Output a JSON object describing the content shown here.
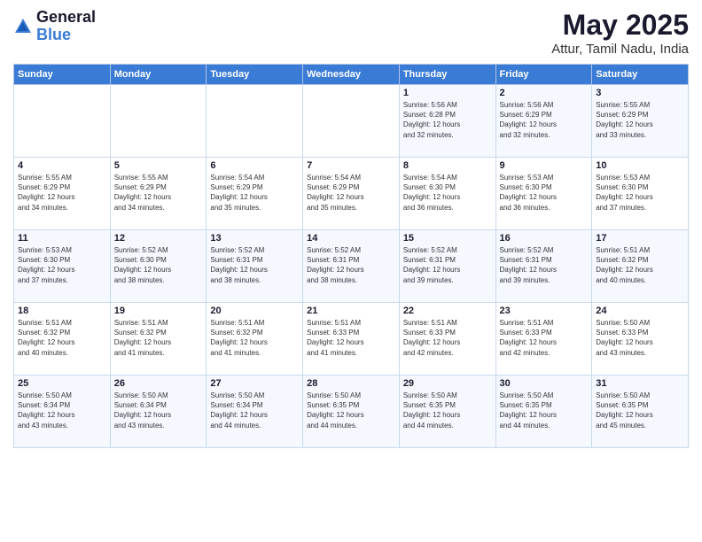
{
  "logo": {
    "general": "General",
    "blue": "Blue"
  },
  "title": "May 2025",
  "subtitle": "Attur, Tamil Nadu, India",
  "days_of_week": [
    "Sunday",
    "Monday",
    "Tuesday",
    "Wednesday",
    "Thursday",
    "Friday",
    "Saturday"
  ],
  "weeks": [
    [
      {
        "day": "",
        "info": ""
      },
      {
        "day": "",
        "info": ""
      },
      {
        "day": "",
        "info": ""
      },
      {
        "day": "",
        "info": ""
      },
      {
        "day": "1",
        "info": "Sunrise: 5:56 AM\nSunset: 6:28 PM\nDaylight: 12 hours\nand 32 minutes."
      },
      {
        "day": "2",
        "info": "Sunrise: 5:56 AM\nSunset: 6:29 PM\nDaylight: 12 hours\nand 32 minutes."
      },
      {
        "day": "3",
        "info": "Sunrise: 5:55 AM\nSunset: 6:29 PM\nDaylight: 12 hours\nand 33 minutes."
      }
    ],
    [
      {
        "day": "4",
        "info": "Sunrise: 5:55 AM\nSunset: 6:29 PM\nDaylight: 12 hours\nand 34 minutes."
      },
      {
        "day": "5",
        "info": "Sunrise: 5:55 AM\nSunset: 6:29 PM\nDaylight: 12 hours\nand 34 minutes."
      },
      {
        "day": "6",
        "info": "Sunrise: 5:54 AM\nSunset: 6:29 PM\nDaylight: 12 hours\nand 35 minutes."
      },
      {
        "day": "7",
        "info": "Sunrise: 5:54 AM\nSunset: 6:29 PM\nDaylight: 12 hours\nand 35 minutes."
      },
      {
        "day": "8",
        "info": "Sunrise: 5:54 AM\nSunset: 6:30 PM\nDaylight: 12 hours\nand 36 minutes."
      },
      {
        "day": "9",
        "info": "Sunrise: 5:53 AM\nSunset: 6:30 PM\nDaylight: 12 hours\nand 36 minutes."
      },
      {
        "day": "10",
        "info": "Sunrise: 5:53 AM\nSunset: 6:30 PM\nDaylight: 12 hours\nand 37 minutes."
      }
    ],
    [
      {
        "day": "11",
        "info": "Sunrise: 5:53 AM\nSunset: 6:30 PM\nDaylight: 12 hours\nand 37 minutes."
      },
      {
        "day": "12",
        "info": "Sunrise: 5:52 AM\nSunset: 6:30 PM\nDaylight: 12 hours\nand 38 minutes."
      },
      {
        "day": "13",
        "info": "Sunrise: 5:52 AM\nSunset: 6:31 PM\nDaylight: 12 hours\nand 38 minutes."
      },
      {
        "day": "14",
        "info": "Sunrise: 5:52 AM\nSunset: 6:31 PM\nDaylight: 12 hours\nand 38 minutes."
      },
      {
        "day": "15",
        "info": "Sunrise: 5:52 AM\nSunset: 6:31 PM\nDaylight: 12 hours\nand 39 minutes."
      },
      {
        "day": "16",
        "info": "Sunrise: 5:52 AM\nSunset: 6:31 PM\nDaylight: 12 hours\nand 39 minutes."
      },
      {
        "day": "17",
        "info": "Sunrise: 5:51 AM\nSunset: 6:32 PM\nDaylight: 12 hours\nand 40 minutes."
      }
    ],
    [
      {
        "day": "18",
        "info": "Sunrise: 5:51 AM\nSunset: 6:32 PM\nDaylight: 12 hours\nand 40 minutes."
      },
      {
        "day": "19",
        "info": "Sunrise: 5:51 AM\nSunset: 6:32 PM\nDaylight: 12 hours\nand 41 minutes."
      },
      {
        "day": "20",
        "info": "Sunrise: 5:51 AM\nSunset: 6:32 PM\nDaylight: 12 hours\nand 41 minutes."
      },
      {
        "day": "21",
        "info": "Sunrise: 5:51 AM\nSunset: 6:33 PM\nDaylight: 12 hours\nand 41 minutes."
      },
      {
        "day": "22",
        "info": "Sunrise: 5:51 AM\nSunset: 6:33 PM\nDaylight: 12 hours\nand 42 minutes."
      },
      {
        "day": "23",
        "info": "Sunrise: 5:51 AM\nSunset: 6:33 PM\nDaylight: 12 hours\nand 42 minutes."
      },
      {
        "day": "24",
        "info": "Sunrise: 5:50 AM\nSunset: 6:33 PM\nDaylight: 12 hours\nand 43 minutes."
      }
    ],
    [
      {
        "day": "25",
        "info": "Sunrise: 5:50 AM\nSunset: 6:34 PM\nDaylight: 12 hours\nand 43 minutes."
      },
      {
        "day": "26",
        "info": "Sunrise: 5:50 AM\nSunset: 6:34 PM\nDaylight: 12 hours\nand 43 minutes."
      },
      {
        "day": "27",
        "info": "Sunrise: 5:50 AM\nSunset: 6:34 PM\nDaylight: 12 hours\nand 44 minutes."
      },
      {
        "day": "28",
        "info": "Sunrise: 5:50 AM\nSunset: 6:35 PM\nDaylight: 12 hours\nand 44 minutes."
      },
      {
        "day": "29",
        "info": "Sunrise: 5:50 AM\nSunset: 6:35 PM\nDaylight: 12 hours\nand 44 minutes."
      },
      {
        "day": "30",
        "info": "Sunrise: 5:50 AM\nSunset: 6:35 PM\nDaylight: 12 hours\nand 44 minutes."
      },
      {
        "day": "31",
        "info": "Sunrise: 5:50 AM\nSunset: 6:35 PM\nDaylight: 12 hours\nand 45 minutes."
      }
    ]
  ]
}
